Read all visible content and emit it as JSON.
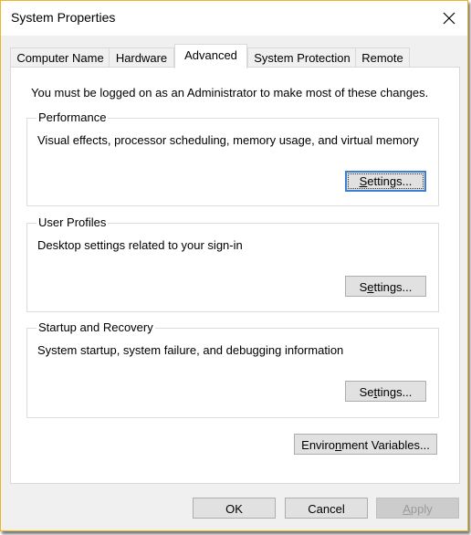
{
  "window": {
    "title": "System Properties",
    "close_icon": "close-x-icon",
    "border_color": "#f0b429"
  },
  "tabs": [
    {
      "label": "Computer Name",
      "active": false
    },
    {
      "label": "Hardware",
      "active": false
    },
    {
      "label": "Advanced",
      "active": true
    },
    {
      "label": "System Protection",
      "active": false
    },
    {
      "label": "Remote",
      "active": false
    }
  ],
  "notice": "You must be logged on as an Administrator to make most of these changes.",
  "groups": [
    {
      "label": "Performance",
      "description": "Visual effects, processor scheduling, memory usage, and virtual memory",
      "button": {
        "pre": "",
        "mnemonic": "S",
        "post": "ettings...",
        "focused": true
      }
    },
    {
      "label": "User Profiles",
      "description": "Desktop settings related to your sign-in",
      "button": {
        "pre": "S",
        "mnemonic": "e",
        "post": "ttings...",
        "focused": false
      }
    },
    {
      "label": "Startup and Recovery",
      "description": "System startup, system failure, and debugging information",
      "button": {
        "pre": "Se",
        "mnemonic": "t",
        "post": "tings...",
        "focused": false
      }
    }
  ],
  "env_button": {
    "pre": "Enviro",
    "mnemonic": "n",
    "post": "ment Variables..."
  },
  "footer": {
    "ok": "OK",
    "cancel": "Cancel",
    "apply": {
      "pre": "",
      "mnemonic": "A",
      "post": "pply",
      "disabled": true
    }
  }
}
